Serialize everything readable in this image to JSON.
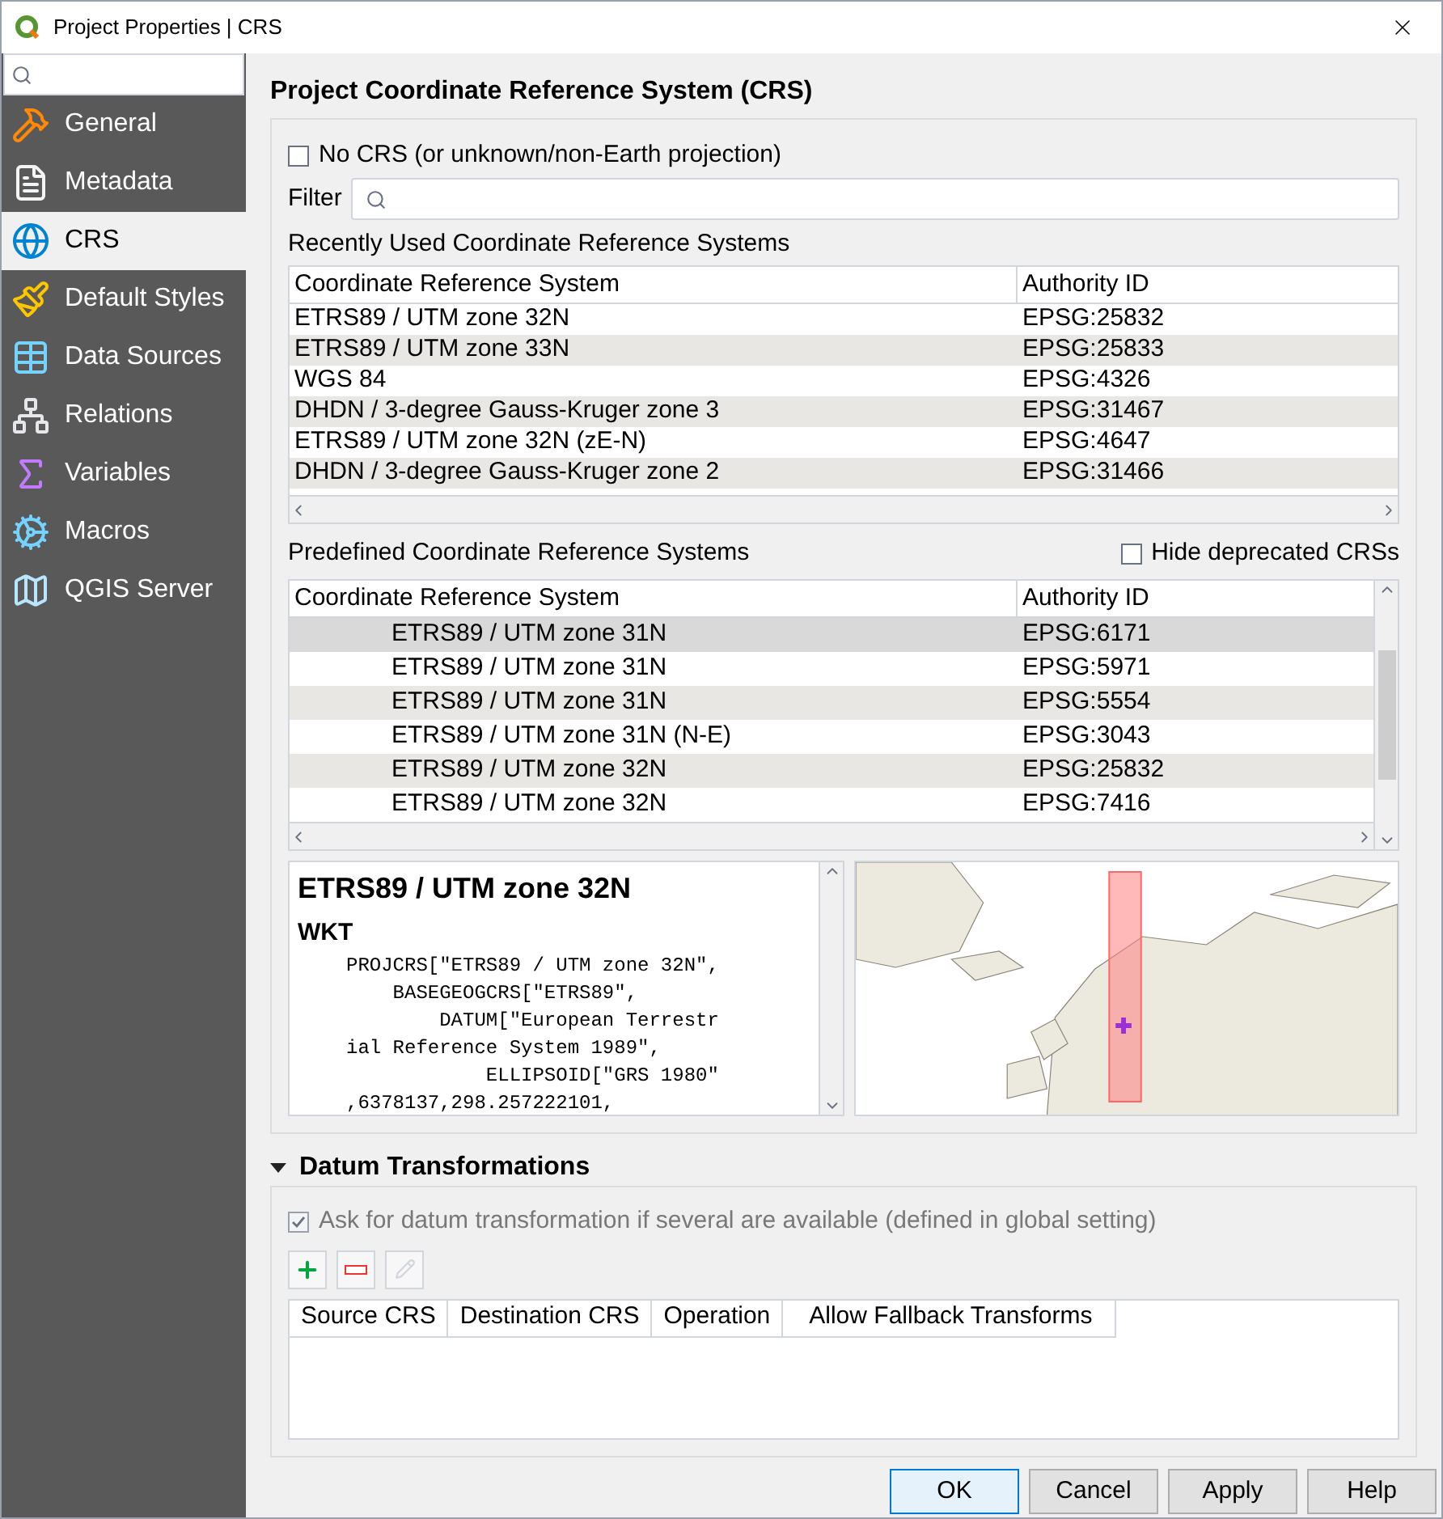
{
  "window": {
    "title": "Project Properties | CRS"
  },
  "sidebar": {
    "items": [
      {
        "label": "General",
        "selected": false
      },
      {
        "label": "Metadata",
        "selected": false
      },
      {
        "label": "CRS",
        "selected": true
      },
      {
        "label": "Default Styles",
        "selected": false
      },
      {
        "label": "Data Sources",
        "selected": false
      },
      {
        "label": "Relations",
        "selected": false
      },
      {
        "label": "Variables",
        "selected": false
      },
      {
        "label": "Macros",
        "selected": false
      },
      {
        "label": "QGIS Server",
        "selected": false
      }
    ]
  },
  "crs": {
    "heading": "Project Coordinate Reference System (CRS)",
    "no_crs": {
      "label": "No CRS (or unknown/non-Earth projection)",
      "checked": false
    },
    "filter": {
      "label": "Filter"
    },
    "recent": {
      "title": "Recently Used Coordinate Reference Systems",
      "columns": [
        "Coordinate Reference System",
        "Authority ID"
      ],
      "rows": [
        {
          "name": "ETRS89 / UTM zone 32N",
          "id": "EPSG:25832"
        },
        {
          "name": "ETRS89 / UTM zone 33N",
          "id": "EPSG:25833"
        },
        {
          "name": "WGS 84",
          "id": "EPSG:4326"
        },
        {
          "name": "DHDN / 3-degree Gauss-Kruger zone 3",
          "id": "EPSG:31467"
        },
        {
          "name": "ETRS89 / UTM zone 32N (zE-N)",
          "id": "EPSG:4647"
        },
        {
          "name": "DHDN / 3-degree Gauss-Kruger zone 2",
          "id": "EPSG:31466"
        }
      ]
    },
    "predefined": {
      "title": "Predefined Coordinate Reference Systems",
      "hide_deprecated": {
        "label": "Hide deprecated CRSs",
        "checked": false
      },
      "columns": [
        "Coordinate Reference System",
        "Authority ID"
      ],
      "rows": [
        {
          "name": "ETRS89 / UTM zone 31N",
          "id": "EPSG:6171",
          "selected": true
        },
        {
          "name": "ETRS89 / UTM zone 31N",
          "id": "EPSG:5971",
          "selected": false
        },
        {
          "name": "ETRS89 / UTM zone 31N",
          "id": "EPSG:5554",
          "selected": false
        },
        {
          "name": "ETRS89 / UTM zone 31N (N-E)",
          "id": "EPSG:3043",
          "selected": false
        },
        {
          "name": "ETRS89 / UTM zone 32N",
          "id": "EPSG:25832",
          "selected": false
        },
        {
          "name": "ETRS89 / UTM zone 32N",
          "id": "EPSG:7416",
          "selected": false
        }
      ]
    },
    "details": {
      "title": "ETRS89 / UTM zone 32N",
      "section": "WKT",
      "lines": [
        "PROJCRS[\"ETRS89 / UTM zone 32N\",",
        "    BASEGEOGCRS[\"ETRS89\",",
        "        DATUM[\"European Terrestr",
        "ial Reference System 1989\",",
        "            ELLIPSOID[\"GRS 1980\"",
        ",6378137,298.257222101,"
      ]
    }
  },
  "datum": {
    "title": "Datum Transformations",
    "expanded": true,
    "ask": {
      "label": "Ask for datum transformation if several are available (defined in global setting)",
      "checked": true,
      "disabled": true
    },
    "columns": [
      "Source CRS",
      "Destination CRS",
      "Operation",
      "Allow Fallback Transforms"
    ]
  },
  "buttons": [
    {
      "label": "OK",
      "default": true
    },
    {
      "label": "Cancel",
      "default": false
    },
    {
      "label": "Apply",
      "default": false
    },
    {
      "label": "Help",
      "default": false
    }
  ]
}
